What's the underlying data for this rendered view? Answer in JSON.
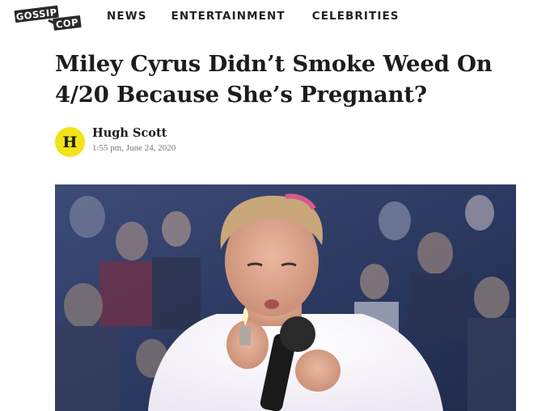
{
  "header": {
    "logo": {
      "line1": "GOSSIP",
      "line2": "COP"
    },
    "nav": [
      {
        "label": "NEWS"
      },
      {
        "label": "ENTERTAINMENT"
      },
      {
        "label": "CELEBRITIES"
      }
    ]
  },
  "article": {
    "headline": "Miley Cyrus Didn’t Smoke Weed On 4/20 Because She’s Pregnant?",
    "author": {
      "initial": "H",
      "name": "Hugh Scott"
    },
    "date": "1:55 pm, June 24, 2020",
    "hero_image": {
      "description_icon": "photo-icon"
    }
  },
  "colors": {
    "avatar_bg": "#f2e21a",
    "text": "#1c1c1c",
    "muted": "#777777",
    "logo": "#2a2a2a"
  }
}
